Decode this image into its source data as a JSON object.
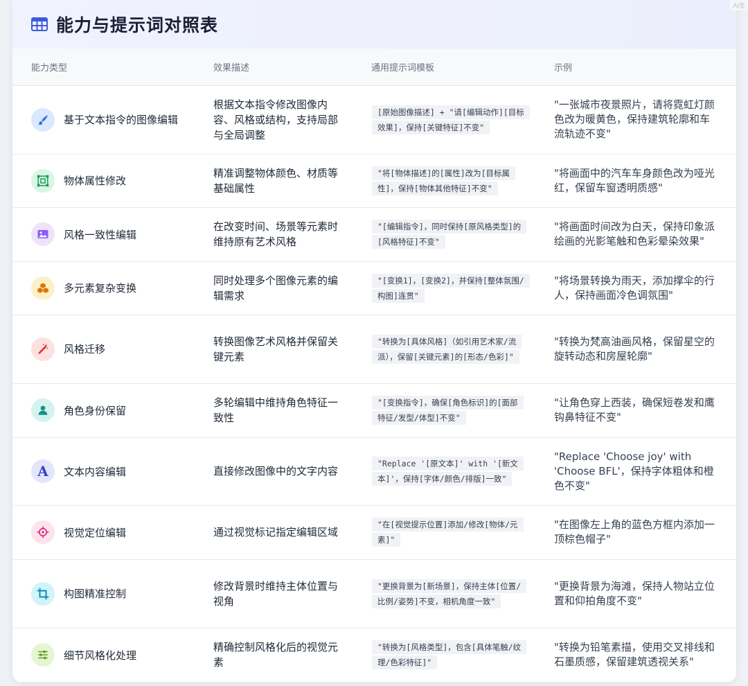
{
  "header": {
    "title": "能力与提示词对照表",
    "icon": "table-grid-icon",
    "accent": "#3b5bdb"
  },
  "watermark": "AI生",
  "columns": {
    "capability": "能力类型",
    "description": "效果描述",
    "template": "通用提示词模板",
    "example": "示例"
  },
  "rows": [
    {
      "icon": "brush-icon",
      "icon_bg": "#dbe8fd",
      "icon_color": "#2f6fe4",
      "capability": "基于文本指令的图像编辑",
      "description": "根据文本指令修改图像内容、风格或结构，支持局部与全局调整",
      "template": "[原始图像描述] + \"请[编辑动作][目标效果]，保持[关键特征]不变\"",
      "example": "\"一张城市夜景照片，请将霓虹灯颜色改为暖黄色，保持建筑轮廓和车流轨迹不变\""
    },
    {
      "icon": "object-frame-icon",
      "icon_bg": "#d9f5e6",
      "icon_color": "#1f9d5c",
      "capability": "物体属性修改",
      "description": "精准调整物体颜色、材质等基础属性",
      "template": "\"将[物体描述]的[属性]改为[目标属性]，保持[物体其他特征]不变\"",
      "example": "\"将画面中的汽车车身颜色改为哑光红，保留车窗透明质感\""
    },
    {
      "icon": "image-icon",
      "icon_bg": "#ede4fb",
      "icon_color": "#8b5cf6",
      "capability": "风格一致性编辑",
      "description": "在改变时间、场景等元素时维持原有艺术风格",
      "template": "\"[编辑指令]，同时保持[原风格类型]的[风格特征]不变\"",
      "example": "\"将画面时间改为白天，保持印象派绘画的光影笔触和色彩晕染效果\""
    },
    {
      "icon": "cubes-icon",
      "icon_bg": "#fdf0c8",
      "icon_color": "#d97706",
      "capability": "多元素复杂变换",
      "description": "同时处理多个图像元素的编辑需求",
      "template": "\"[变换1]，[变换2]，并保持[整体氛围/构图]连贯\"",
      "example": "\"将场景转换为雨天，添加撑伞的行人，保持画面冷色调氛围\""
    },
    {
      "icon": "magic-wand-icon",
      "icon_bg": "#fde1e1",
      "icon_color": "#e03131",
      "capability": "风格迁移",
      "description": "转换图像艺术风格并保留关键元素",
      "template": "\"转换为[具体风格]（如引用艺术家/流派），保留[关键元素]的[形态/色彩]\"",
      "example": "\"转换为梵高油画风格，保留星空的旋转动态和房屋轮廓\""
    },
    {
      "icon": "user-icon",
      "icon_bg": "#d4f3ee",
      "icon_color": "#0f9488",
      "capability": "角色身份保留",
      "description": "多轮编辑中维持角色特征一致性",
      "template": "\"[变换指令]，确保[角色标识]的[面部特征/发型/体型]不变\"",
      "example": "\"让角色穿上西装，确保短卷发和鹰钩鼻特征不变\""
    },
    {
      "icon": "letter-a-icon",
      "icon_bg": "#e3e6fb",
      "icon_color": "#3b3fc4",
      "capability": "文本内容编辑",
      "description": "直接修改图像中的文字内容",
      "template": "\"Replace '[原文本]' with '[新文本]'，保持[字体/颜色/排版]一致\"",
      "example": "\"Replace 'Choose joy' with 'Choose BFL'，保持字体粗体和橙色不变\""
    },
    {
      "icon": "crosshair-icon",
      "icon_bg": "#fde3ee",
      "icon_color": "#db2777",
      "capability": "视觉定位编辑",
      "description": "通过视觉标记指定编辑区域",
      "template": "\"在[视觉提示位置]添加/修改[物体/元素]\"",
      "example": "\"在图像左上角的蓝色方框内添加一顶棕色帽子\""
    },
    {
      "icon": "crop-icon",
      "icon_bg": "#d2f3fa",
      "icon_color": "#0891b2",
      "capability": "构图精准控制",
      "description": "修改背景时维持主体位置与视角",
      "template": "\"更换背景为[新场景]，保持主体[位置/比例/姿势]不变，相机角度一致\"",
      "example": "\"更换背景为海滩，保持人物站立位置和仰拍角度不变\""
    },
    {
      "icon": "sliders-icon",
      "icon_bg": "#e6f6d2",
      "icon_color": "#5d9e1e",
      "capability": "细节风格化处理",
      "description": "精确控制风格化后的视觉元素",
      "template": "\"转换为[风格类型]，包含[具体笔触/纹理/色彩特征]\"",
      "example": "\"转换为铅笔素描，使用交叉排线和石墨质感，保留建筑透视关系\""
    }
  ]
}
